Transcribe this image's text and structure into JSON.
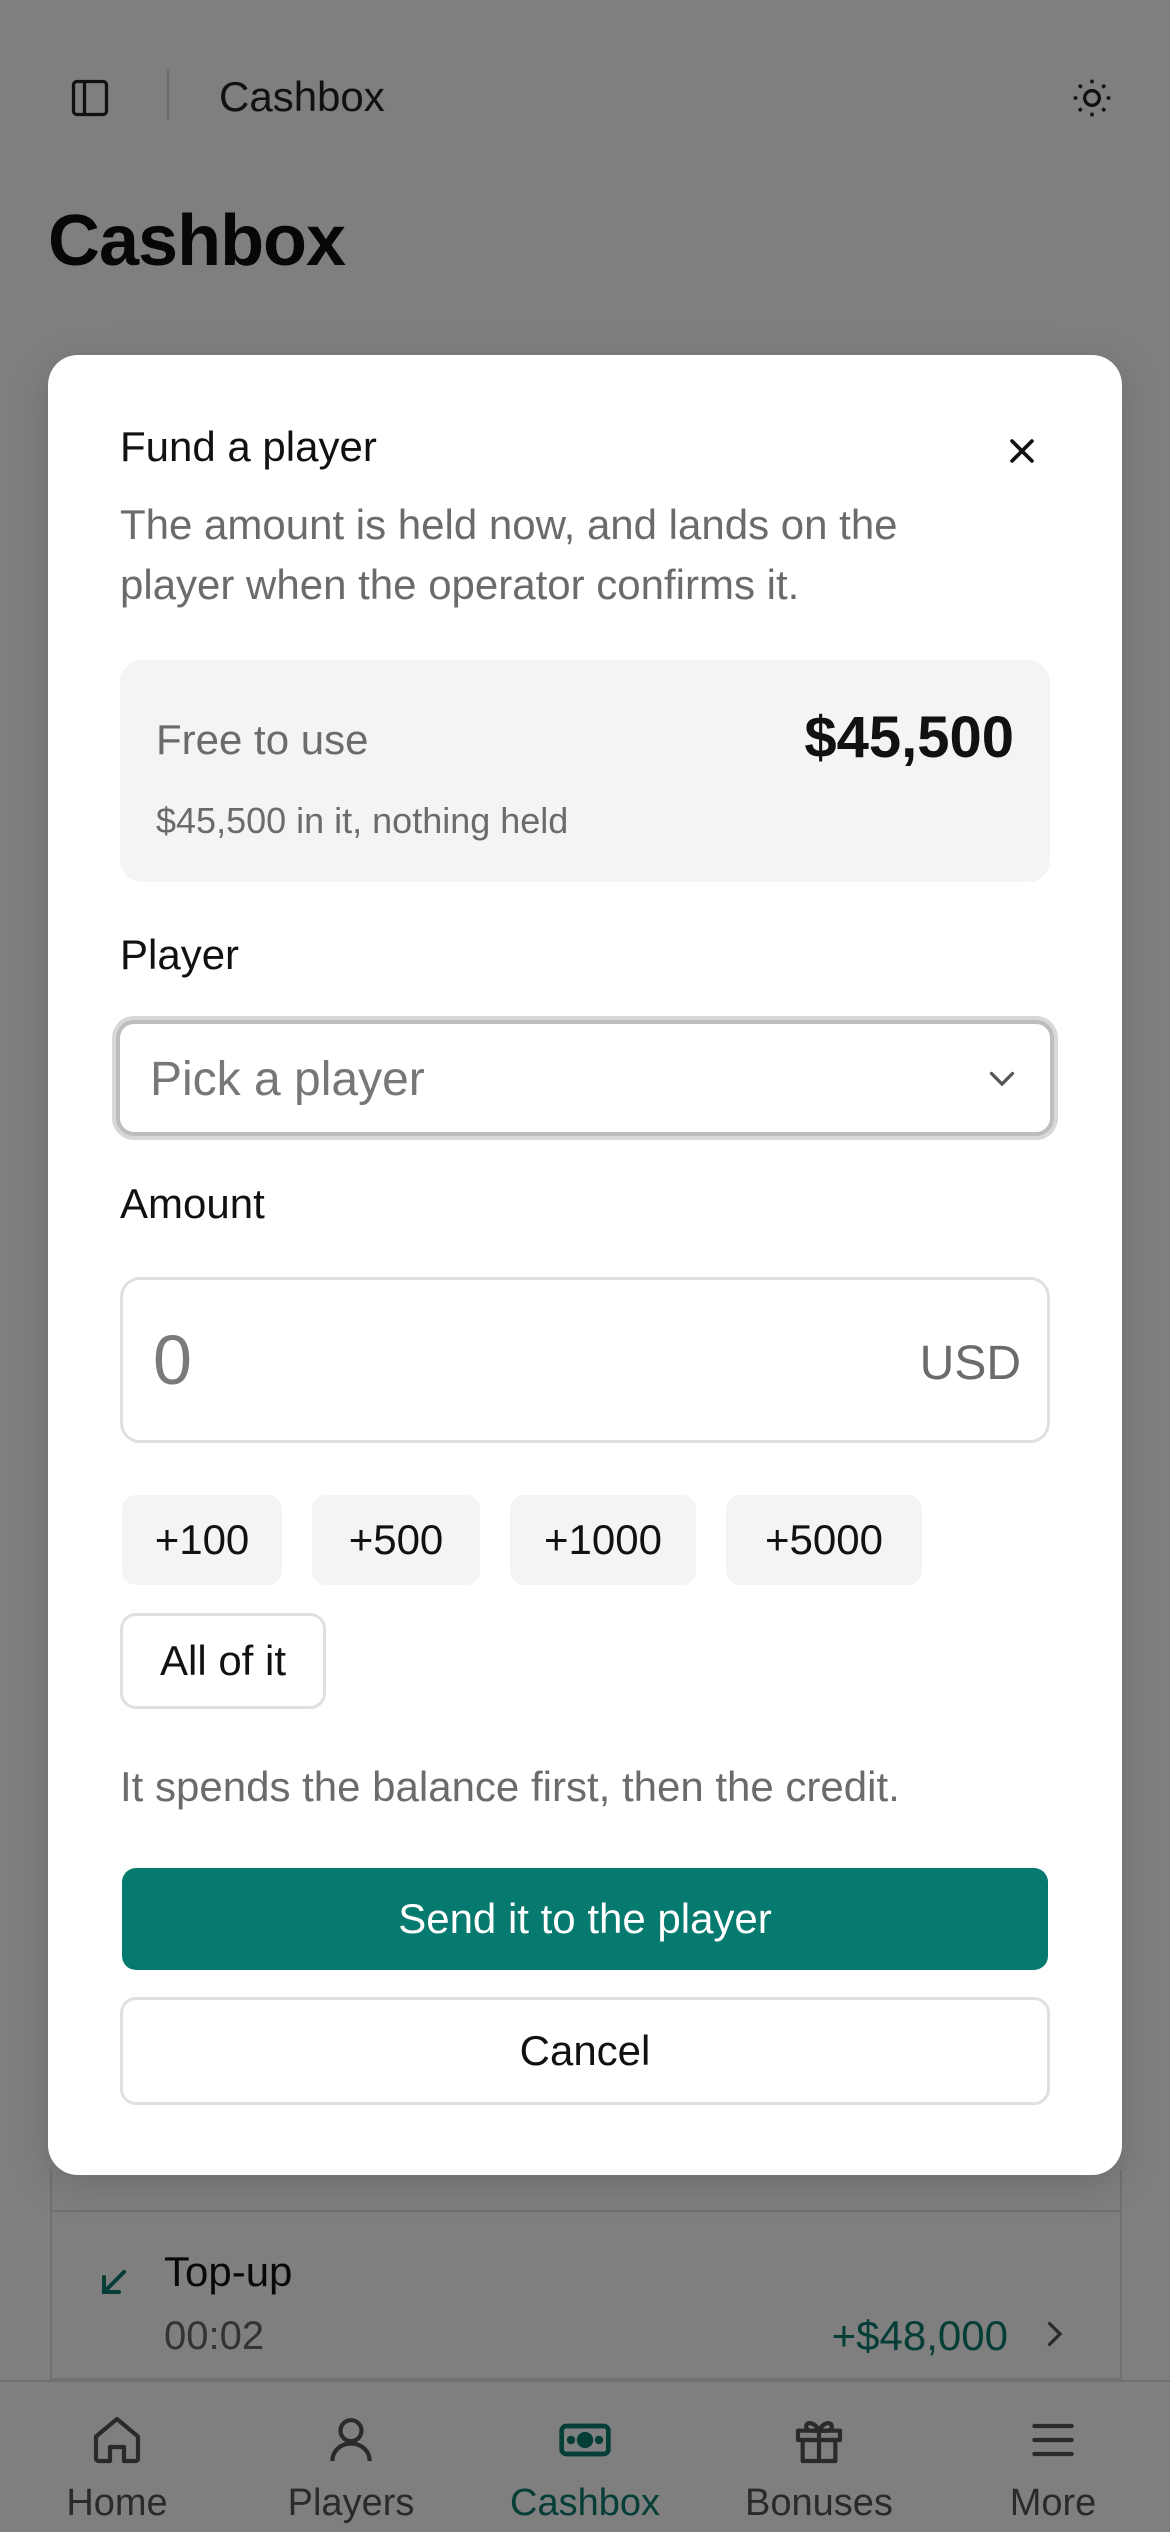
{
  "header": {
    "title": "Cashbox",
    "sidebar_icon": "sidebar-panel-icon",
    "theme_icon": "sun-icon"
  },
  "page": {
    "title": "Cashbox"
  },
  "transaction": {
    "title": "Top-up",
    "time": "00:02",
    "amount": "+$48,000",
    "icon": "arrow-down-left-icon"
  },
  "tabs": [
    {
      "label": "Home",
      "icon": "home-icon",
      "active": false
    },
    {
      "label": "Players",
      "icon": "user-icon",
      "active": false
    },
    {
      "label": "Cashbox",
      "icon": "banknote-icon",
      "active": true
    },
    {
      "label": "Bonuses",
      "icon": "gift-icon",
      "active": false
    },
    {
      "label": "More",
      "icon": "menu-icon",
      "active": false
    }
  ],
  "modal": {
    "title": "Fund a player",
    "description": "The amount is held now, and lands on the player when the operator confirms it.",
    "balance": {
      "label": "Free to use",
      "value": "$45,500",
      "sub": "$45,500 in it, nothing held"
    },
    "player_label": "Player",
    "player_placeholder": "Pick a player",
    "amount_label": "Amount",
    "amount_value": "0",
    "currency": "USD",
    "quick_amounts": [
      "+100",
      "+500",
      "+1000",
      "+5000"
    ],
    "all_label": "All of it",
    "hint": "It spends the balance first, then the credit.",
    "send_label": "Send it to the player",
    "cancel_label": "Cancel"
  },
  "colors": {
    "accent": "#077a6f",
    "overlay": "rgba(0,0,0,0.5)"
  }
}
